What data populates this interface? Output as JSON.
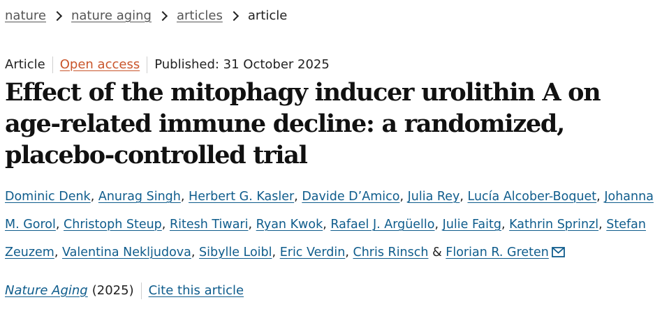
{
  "breadcrumb": {
    "items": [
      "nature",
      "nature aging",
      "articles"
    ],
    "current": "article"
  },
  "meta": {
    "type": "Article",
    "access": "Open access",
    "published": "Published: 31 October 2025"
  },
  "title": "Effect of the mitophagy inducer urolithin A on age-related immune decline: a randomized, placebo-controlled trial",
  "authors": {
    "names": [
      "Dominic Denk",
      "Anurag Singh",
      "Herbert G. Kasler",
      "Davide D’Amico",
      "Julia Rey",
      "Lucía Alcober-Boquet",
      "Johanna M. Gorol",
      "Christoph Steup",
      "Ritesh Tiwari",
      "Ryan Kwok",
      "Rafael J. Argüello",
      "Julie Faitg",
      "Kathrin Sprinzl",
      "Stefan Zeuzem",
      "Valentina Nekljudova",
      "Sibylle Loibl",
      "Eric Verdin",
      "Chris Rinsch"
    ],
    "sep": ",",
    "and": "&",
    "last": "Florian R. Greten"
  },
  "citation": {
    "journal": "Nature Aging",
    "year": "(2025)",
    "cite": "Cite this article"
  },
  "colors": {
    "link": "#0f5c8c",
    "open_access": "#c9552b",
    "text": "#222222"
  },
  "icons": {
    "mail": "envelope-icon",
    "separator": "chevron-right-icon"
  }
}
